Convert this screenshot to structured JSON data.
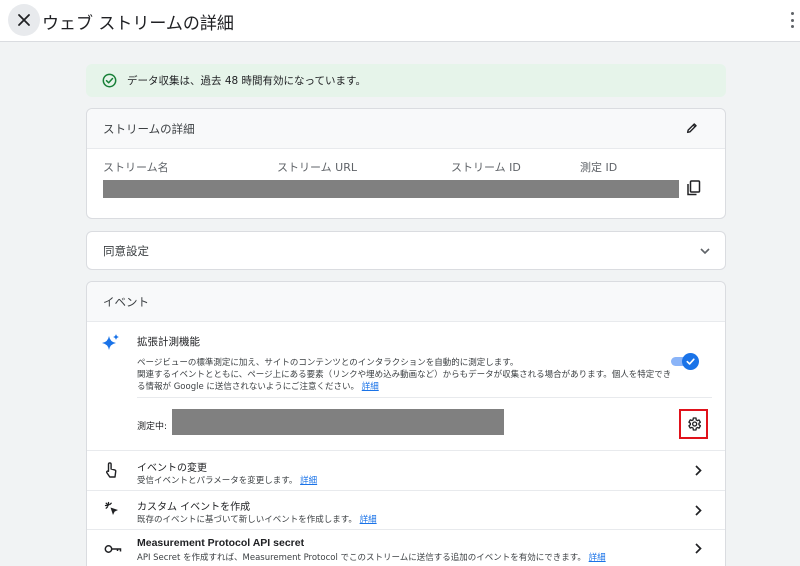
{
  "header": {
    "title": "ウェブ ストリームの詳細"
  },
  "banner": {
    "text": "データ収集は、過去 48 時間有効になっています。"
  },
  "stream_details": {
    "heading": "ストリームの詳細",
    "columns": [
      "ストリーム名",
      "ストリーム URL",
      "ストリーム ID",
      "測定 ID"
    ]
  },
  "consent": {
    "heading": "同意設定"
  },
  "events": {
    "heading": "イベント",
    "enhanced": {
      "title": "拡張計測機能",
      "desc_line1": "ページビューの標準測定に加え、サイトのコンテンツとのインタラクションを自動的に測定します。",
      "desc_line2": "関連するイベントとともに、ページ上にある要素（リンクや埋め込み動画など）からもデータが収集される場合があります。個人を特定できる情報が Google に送信されないようにご注意ください。",
      "learn_more": "詳細",
      "enabled": true,
      "measuring_label": "測定中:"
    },
    "rows": [
      {
        "title": "イベントの変更",
        "desc": "受信イベントとパラメータを変更します。",
        "link": "詳細"
      },
      {
        "title": "カスタム イベントを作成",
        "desc": "既存のイベントに基づいて新しいイベントを作成します。",
        "link": "詳細"
      },
      {
        "title": "Measurement Protocol API secret",
        "desc": "API Secret を作成すれば、Measurement Protocol でこのストリームに送信する追加のイベントを有効にできます。",
        "link": "詳細"
      }
    ]
  },
  "icons": {
    "close": "close-icon",
    "more": "more-vert-icon",
    "check": "check-circle-icon",
    "edit": "pencil-icon",
    "copy": "copy-icon",
    "expand": "chevron-down-icon",
    "sparkle": "sparkle-icon",
    "gear": "gear-icon",
    "touch": "touch-icon",
    "cursor": "cursor-click-icon",
    "key": "key-icon",
    "chevron": "chevron-right-icon"
  },
  "colors": {
    "accent": "#1a73e8",
    "success": "#188038",
    "highlight": "#e0121b"
  }
}
